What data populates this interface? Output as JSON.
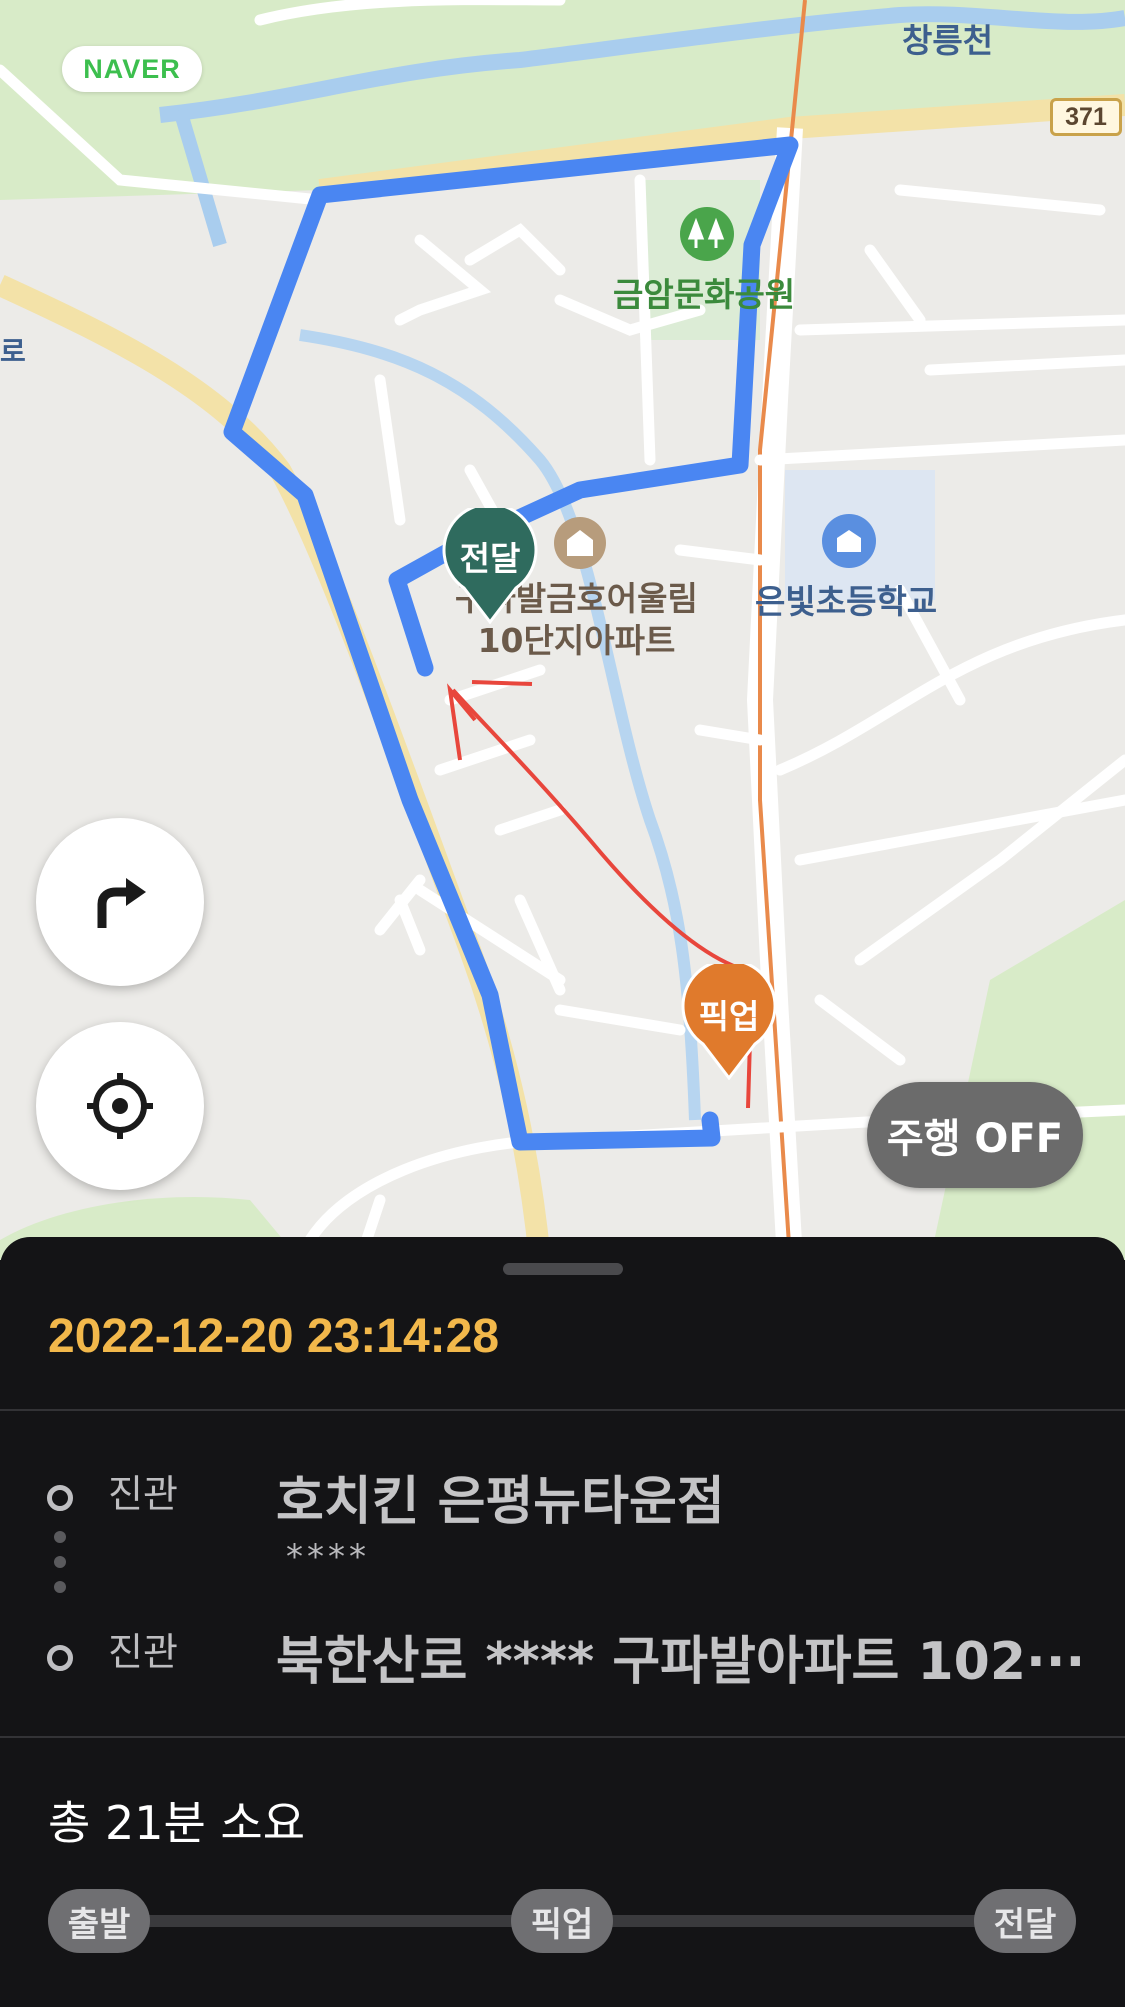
{
  "map": {
    "brand": "NAVER",
    "road_number": "371",
    "labels": {
      "stream": "창릉천",
      "park": "금암문화공원",
      "school": "은빛초등학교",
      "apartment_line1": "구파발금호어울림",
      "apartment_line2": "10단지아파트",
      "edge": "로"
    },
    "markers": {
      "pickup": "픽업",
      "delivery": "전달"
    },
    "drive_toggle": "주행 OFF",
    "icons": {
      "turn": "turn-right-icon",
      "locate": "crosshair-icon",
      "park": "park-icon",
      "school": "school-icon",
      "apartment": "building-icon"
    },
    "colors": {
      "route": "#4a86f2",
      "pickup_marker": "#e07a2c",
      "delivery_marker": "#2f6b5e",
      "annotation": "#e8463c"
    }
  },
  "order": {
    "timestamp": "2022-12-20 23:14:28",
    "pickup": {
      "status": "진관",
      "name": "호치킨 은평뉴타운점",
      "detail": "****"
    },
    "dropoff": {
      "status": "진관",
      "address": "북한산로 **** 구파발아파트 102···"
    },
    "total_time": "총 21분 소요",
    "progress": {
      "start": "출발",
      "pickup": "픽업",
      "delivery": "전달"
    }
  }
}
